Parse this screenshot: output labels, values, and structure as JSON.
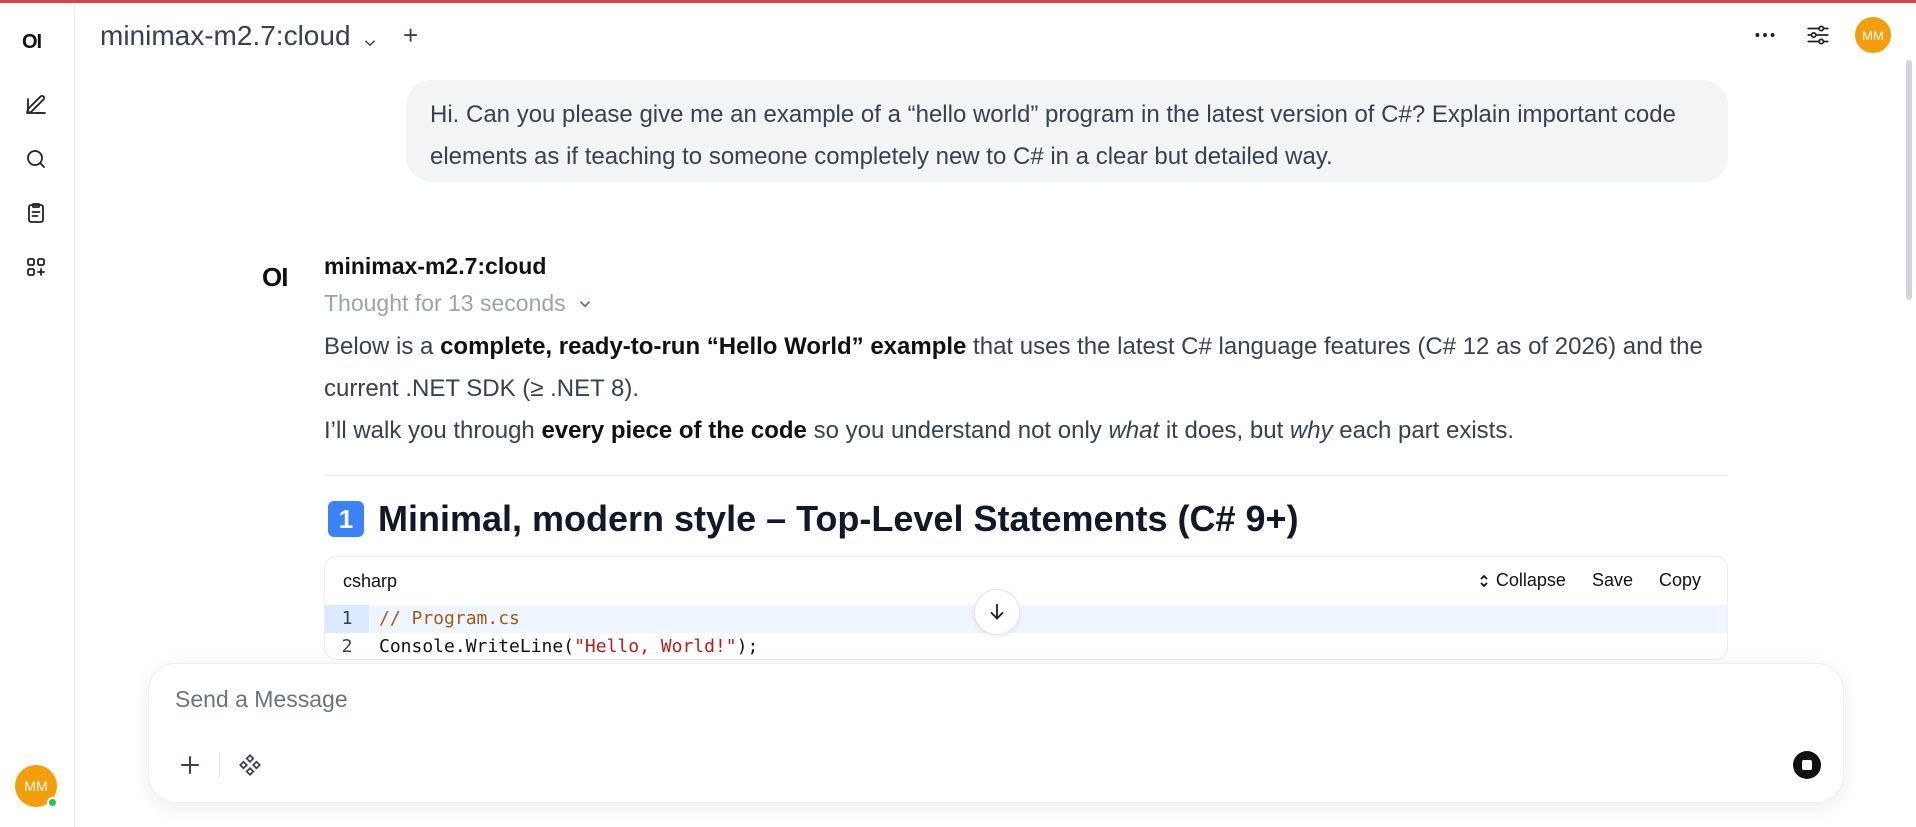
{
  "header": {
    "model_name": "minimax-m2.7:cloud",
    "add_label": "+",
    "avatar_initials": "MM"
  },
  "sidebar": {
    "logo": "OI",
    "items": [
      {
        "icon": "new-chat-icon"
      },
      {
        "icon": "search-icon"
      },
      {
        "icon": "notes-icon"
      },
      {
        "icon": "workspace-icon"
      }
    ],
    "avatar_initials": "MM",
    "status": "online"
  },
  "conversation": {
    "user_message": "Hi. Can you please give me an example of a “hello world” program in the latest version of C#? Explain important code elements as if teaching to someone completely new to C# in a clear but detailed way.",
    "assistant": {
      "logo": "OI",
      "model_name": "minimax-m2.7:cloud",
      "thought_label": "Thought for 13 seconds",
      "para1": {
        "t1": "Below is a ",
        "b1": "complete, ready-to-run “Hello World” example",
        "t2": " that uses the latest C# language features (C# 12 as of 2026) and the current .NET SDK (≥ .NET 8)."
      },
      "para2": {
        "t1": "I’ll walk you through ",
        "b1": "every piece of the code",
        "t2": " so you understand not only ",
        "i1": "what",
        "t3": " it does, but ",
        "i2": "why",
        "t4": " each part exists."
      },
      "heading_badge": "1",
      "heading": "Minimal, modern style – Top-Level Statements (C# 9+)",
      "code_block": {
        "language": "csharp",
        "actions": {
          "collapse": "Collapse",
          "save": "Save",
          "copy": "Copy"
        },
        "lines": [
          {
            "num": "1",
            "comment": "// Program.cs"
          },
          {
            "num": "2",
            "pre": "Console.WriteLine(",
            "string": "\"Hello, World!\"",
            "post": ");"
          }
        ]
      }
    }
  },
  "composer": {
    "placeholder": "Send a Message"
  },
  "colors": {
    "accent_avatar": "#f59e0b",
    "online": "#22c55e",
    "top_line": "#d64545",
    "keycap": "#3b82f6"
  }
}
